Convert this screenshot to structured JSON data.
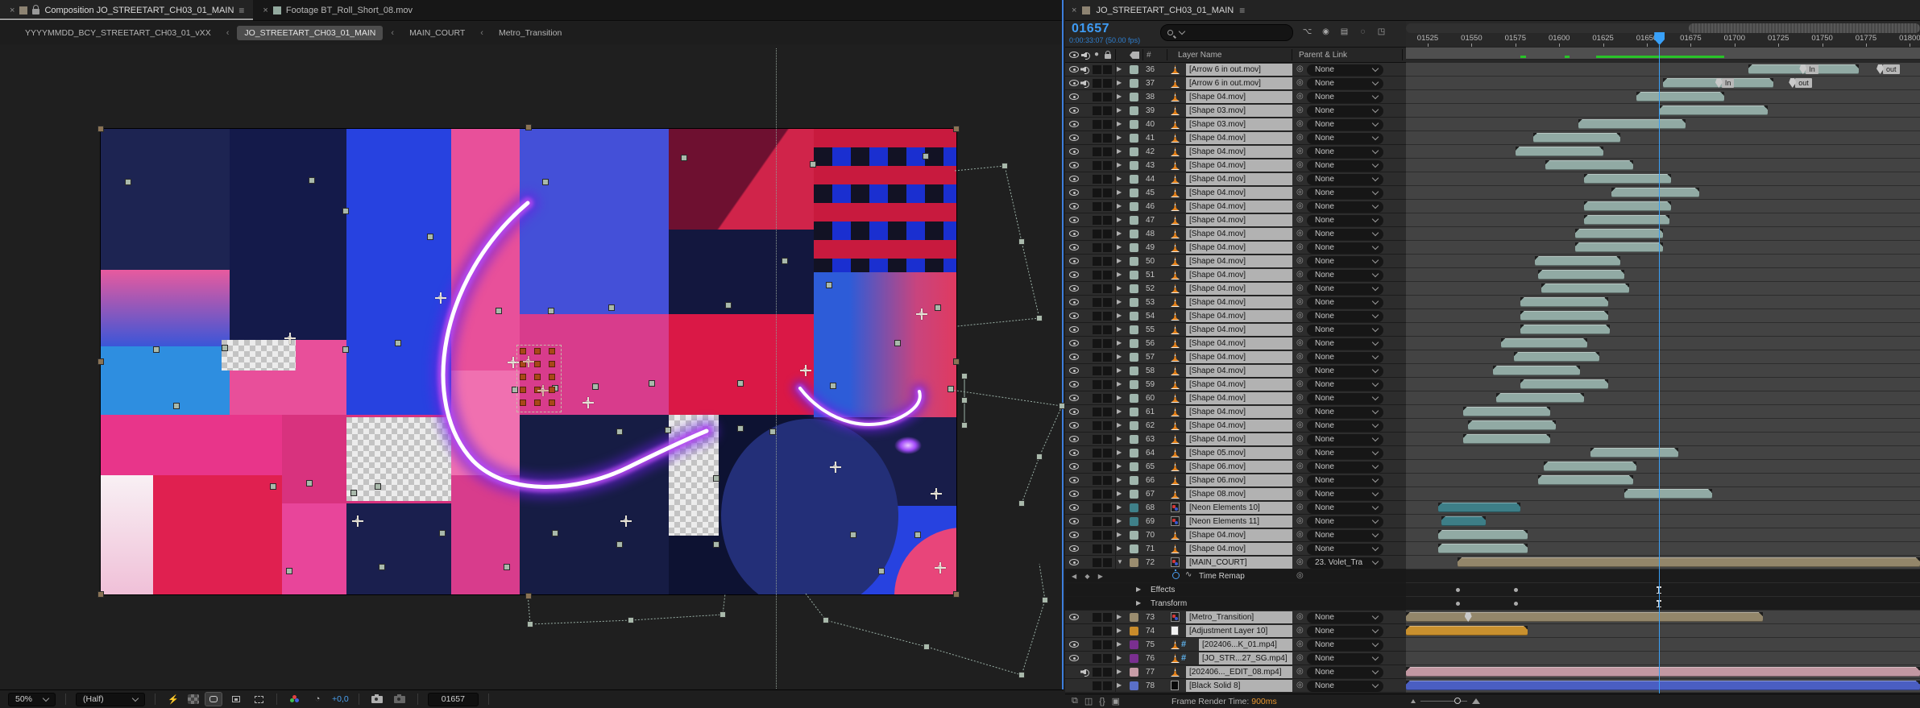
{
  "viewer": {
    "tabs": [
      {
        "label": "Composition JO_STREETART_CH03_01_MAIN",
        "active": true,
        "locked": true
      },
      {
        "label": "Footage BT_Roll_Short_08.mov",
        "active": false
      }
    ],
    "breadcrumbs": [
      "YYYYMMDD_BCY_STREETART_CH03_01_vXX",
      "JO_STREETART_CH03_01_MAIN",
      "MAIN_COURT",
      "Metro_Transition"
    ],
    "active_breadcrumb": "JO_STREETART_CH03_01_MAIN",
    "toolbar": {
      "zoom": "50%",
      "resolution": "(Half)",
      "exposure": "+0,0",
      "timecode": "01657",
      "icons": [
        "fast-previews-icon",
        "transparency-grid-icon",
        "mask-visibility-icon",
        "region-of-interest-icon",
        "guides-crop-icon",
        "channel-rgb-icon",
        "exposure-reset-icon",
        "snapshot-icon",
        "show-snapshot-icon"
      ]
    }
  },
  "timeline": {
    "tab": "JO_STREETART_CH03_01_MAIN",
    "current_frame": "01657",
    "current_time": "0:00:33:07 (50.00 fps)",
    "playhead_frame": 1657,
    "columns": {
      "layer_name": "Layer Name",
      "parent": "Parent & Link",
      "number": "#"
    },
    "mode_icons": [
      "composition-mini-flowchart-icon",
      "shy-layers-icon",
      "frame-blending-icon",
      "motion-blur-icon",
      "graph-editor-icon"
    ],
    "ruler_ticks": [
      "01525",
      "01550",
      "01575",
      "01600",
      "01625",
      "01650",
      "01675",
      "01700",
      "01725",
      "01750",
      "01775",
      "01800"
    ],
    "ruler_start": 1525,
    "ruler_step": 25,
    "green_cache_segments": [
      [
        1578,
        1581
      ],
      [
        1603,
        1606
      ],
      [
        1621,
        1694
      ]
    ],
    "colors": {
      "chips": {
        "sage": "#9fb5ac",
        "teal": "#3f8089",
        "tan": "#9b8d6f",
        "orange": "#c98c2a",
        "purple": "#7a2f90",
        "pink": "#c79ca6",
        "blue": "#5a6fc8"
      },
      "bars": {
        "sage": "#91aaa4",
        "teal": "#3d7e87",
        "tan": "#93866a",
        "orange": "#c8902e",
        "pink": "#c298a2",
        "blue": "#4a5ec2"
      },
      "accent_blue": "#38a0f8"
    },
    "rows": [
      {
        "num": 36,
        "name": "[Arrow 6 in out.mov]",
        "icon": "footage",
        "chip": "sage",
        "eye": true,
        "audio": true,
        "parent": "None",
        "bar": {
          "s": 1708,
          "e": 1771,
          "c": "sage"
        },
        "markers": [
          {
            "t": "In",
            "f": 1737
          },
          {
            "t": "out",
            "f": 1781
          }
        ]
      },
      {
        "num": 37,
        "name": "[Arrow 6 in out.mov]",
        "icon": "footage",
        "chip": "sage",
        "eye": true,
        "audio": true,
        "parent": "None",
        "bar": {
          "s": 1659,
          "e": 1722,
          "c": "sage"
        },
        "markers": [
          {
            "t": "In",
            "f": 1689
          },
          {
            "t": "out",
            "f": 1731
          }
        ]
      },
      {
        "num": 38,
        "name": "[Shape 04.mov]",
        "icon": "footage",
        "chip": "sage",
        "eye": true,
        "parent": "None",
        "bar": {
          "s": 1644,
          "e": 1694,
          "c": "sage"
        }
      },
      {
        "num": 39,
        "name": "[Shape 03.mov]",
        "icon": "footage",
        "chip": "sage",
        "eye": true,
        "parent": "None",
        "bar": {
          "s": 1657,
          "e": 1719,
          "c": "sage"
        }
      },
      {
        "num": 40,
        "name": "[Shape 03.mov]",
        "icon": "footage",
        "chip": "sage",
        "eye": true,
        "parent": "None",
        "bar": {
          "s": 1611,
          "e": 1672,
          "c": "sage"
        }
      },
      {
        "num": 41,
        "name": "[Shape 04.mov]",
        "icon": "footage",
        "chip": "sage",
        "eye": true,
        "parent": "None",
        "bar": {
          "s": 1585,
          "e": 1635,
          "c": "sage"
        }
      },
      {
        "num": 42,
        "name": "[Shape 04.mov]",
        "icon": "footage",
        "chip": "sage",
        "eye": true,
        "parent": "None",
        "bar": {
          "s": 1575,
          "e": 1625,
          "c": "sage"
        }
      },
      {
        "num": 43,
        "name": "[Shape 04.mov]",
        "icon": "footage",
        "chip": "sage",
        "eye": true,
        "parent": "None",
        "bar": {
          "s": 1592,
          "e": 1642,
          "c": "sage"
        }
      },
      {
        "num": 44,
        "name": "[Shape 04.mov]",
        "icon": "footage",
        "chip": "sage",
        "eye": true,
        "parent": "None",
        "bar": {
          "s": 1614,
          "e": 1664,
          "c": "sage"
        }
      },
      {
        "num": 45,
        "name": "[Shape 04.mov]",
        "icon": "footage",
        "chip": "sage",
        "eye": true,
        "parent": "None",
        "bar": {
          "s": 1630,
          "e": 1680,
          "c": "sage"
        }
      },
      {
        "num": 46,
        "name": "[Shape 04.mov]",
        "icon": "footage",
        "chip": "sage",
        "eye": true,
        "parent": "None",
        "bar": {
          "s": 1614,
          "e": 1664,
          "c": "sage"
        }
      },
      {
        "num": 47,
        "name": "[Shape 04.mov]",
        "icon": "footage",
        "chip": "sage",
        "eye": true,
        "parent": "None",
        "bar": {
          "s": 1614,
          "e": 1663,
          "c": "sage"
        }
      },
      {
        "num": 48,
        "name": "[Shape 04.mov]",
        "icon": "footage",
        "chip": "sage",
        "eye": true,
        "parent": "None",
        "bar": {
          "s": 1609,
          "e": 1659,
          "c": "sage"
        }
      },
      {
        "num": 49,
        "name": "[Shape 04.mov]",
        "icon": "footage",
        "chip": "sage",
        "eye": true,
        "parent": "None",
        "bar": {
          "s": 1609,
          "e": 1659,
          "c": "sage"
        }
      },
      {
        "num": 50,
        "name": "[Shape 04.mov]",
        "icon": "footage",
        "chip": "sage",
        "eye": true,
        "parent": "None",
        "bar": {
          "s": 1586,
          "e": 1635,
          "c": "sage"
        }
      },
      {
        "num": 51,
        "name": "[Shape 04.mov]",
        "icon": "footage",
        "chip": "sage",
        "eye": true,
        "parent": "None",
        "bar": {
          "s": 1588,
          "e": 1637,
          "c": "sage"
        }
      },
      {
        "num": 52,
        "name": "[Shape 04.mov]",
        "icon": "footage",
        "chip": "sage",
        "eye": true,
        "parent": "None",
        "bar": {
          "s": 1590,
          "e": 1640,
          "c": "sage"
        }
      },
      {
        "num": 53,
        "name": "[Shape 04.mov]",
        "icon": "footage",
        "chip": "sage",
        "eye": true,
        "parent": "None",
        "bar": {
          "s": 1578,
          "e": 1628,
          "c": "sage"
        }
      },
      {
        "num": 54,
        "name": "[Shape 04.mov]",
        "icon": "footage",
        "chip": "sage",
        "eye": true,
        "parent": "None",
        "bar": {
          "s": 1578,
          "e": 1628,
          "c": "sage"
        }
      },
      {
        "num": 55,
        "name": "[Shape 04.mov]",
        "icon": "footage",
        "chip": "sage",
        "eye": true,
        "parent": "None",
        "bar": {
          "s": 1578,
          "e": 1629,
          "c": "sage"
        }
      },
      {
        "num": 56,
        "name": "[Shape 04.mov]",
        "icon": "footage",
        "chip": "sage",
        "eye": true,
        "parent": "None",
        "bar": {
          "s": 1567,
          "e": 1616,
          "c": "sage"
        }
      },
      {
        "num": 57,
        "name": "[Shape 04.mov]",
        "icon": "footage",
        "chip": "sage",
        "eye": true,
        "parent": "None",
        "bar": {
          "s": 1574,
          "e": 1623,
          "c": "sage"
        }
      },
      {
        "num": 58,
        "name": "[Shape 04.mov]",
        "icon": "footage",
        "chip": "sage",
        "eye": true,
        "parent": "None",
        "bar": {
          "s": 1562,
          "e": 1612,
          "c": "sage"
        }
      },
      {
        "num": 59,
        "name": "[Shape 04.mov]",
        "icon": "footage",
        "chip": "sage",
        "eye": true,
        "parent": "None",
        "bar": {
          "s": 1578,
          "e": 1628,
          "c": "sage"
        }
      },
      {
        "num": 60,
        "name": "[Shape 04.mov]",
        "icon": "footage",
        "chip": "sage",
        "eye": true,
        "parent": "None",
        "bar": {
          "s": 1564,
          "e": 1614,
          "c": "sage"
        }
      },
      {
        "num": 61,
        "name": "[Shape 04.mov]",
        "icon": "footage",
        "chip": "sage",
        "eye": true,
        "parent": "None",
        "bar": {
          "s": 1545,
          "e": 1595,
          "c": "sage"
        }
      },
      {
        "num": 62,
        "name": "[Shape 04.mov]",
        "icon": "footage",
        "chip": "sage",
        "eye": true,
        "parent": "None",
        "bar": {
          "s": 1548,
          "e": 1598,
          "c": "sage"
        }
      },
      {
        "num": 63,
        "name": "[Shape 04.mov]",
        "icon": "footage",
        "chip": "sage",
        "eye": true,
        "parent": "None",
        "bar": {
          "s": 1545,
          "e": 1595,
          "c": "sage"
        }
      },
      {
        "num": 64,
        "name": "[Shape 05.mov]",
        "icon": "footage",
        "chip": "sage",
        "eye": true,
        "parent": "None",
        "bar": {
          "s": 1618,
          "e": 1668,
          "c": "sage"
        }
      },
      {
        "num": 65,
        "name": "[Shape 06.mov]",
        "icon": "footage",
        "chip": "sage",
        "eye": true,
        "parent": "None",
        "bar": {
          "s": 1591,
          "e": 1644,
          "c": "sage"
        }
      },
      {
        "num": 66,
        "name": "[Shape 06.mov]",
        "icon": "footage",
        "chip": "sage",
        "eye": true,
        "parent": "None",
        "bar": {
          "s": 1588,
          "e": 1642,
          "c": "sage"
        }
      },
      {
        "num": 67,
        "name": "[Shape 08.mov]",
        "icon": "footage",
        "chip": "sage",
        "eye": true,
        "parent": "None",
        "bar": {
          "s": 1637,
          "e": 1687,
          "c": "sage"
        }
      },
      {
        "num": 68,
        "name": "[Neon Elements 10]",
        "icon": "comp",
        "chip": "teal",
        "eye": true,
        "parent": "None",
        "bar": {
          "s": 1531,
          "e": 1578,
          "c": "teal"
        }
      },
      {
        "num": 69,
        "name": "[Neon Elements 11]",
        "icon": "comp",
        "chip": "teal",
        "eye": true,
        "parent": "None",
        "bar": {
          "s": 1533,
          "e": 1558,
          "c": "teal"
        }
      },
      {
        "num": 70,
        "name": "[Shape 04.mov]",
        "icon": "footage",
        "chip": "sage",
        "eye": true,
        "parent": "None",
        "bar": {
          "s": 1531,
          "e": 1582,
          "c": "sage"
        }
      },
      {
        "num": 71,
        "name": "[Shape 04.mov]",
        "icon": "footage",
        "chip": "sage",
        "eye": true,
        "parent": "None",
        "bar": {
          "s": 1531,
          "e": 1582,
          "c": "sage"
        }
      },
      {
        "num": 72,
        "name": "[MAIN_COURT]",
        "icon": "comp",
        "chip": "tan",
        "eye": true,
        "expanded": true,
        "parent": "23. Volet_Tra",
        "bar": {
          "s": 1542,
          "e": 1808,
          "c": "tan"
        }
      },
      {
        "prop": "Time Remap",
        "nav": true,
        "stopwatch": true
      },
      {
        "prop": "Effects",
        "dots": [
          1541,
          1574
        ],
        "ibeam": 1657
      },
      {
        "prop": "Transform",
        "dots": [
          1541,
          1574
        ],
        "ibeam": 1657
      },
      {
        "num": 73,
        "name": "[Metro_Transition]",
        "icon": "comp",
        "chip": "tan",
        "eye": true,
        "parent": "None",
        "bar": {
          "s": 1510,
          "e": 1716,
          "c": "tan"
        },
        "markers": [
          {
            "t": "",
            "f": 1546
          }
        ]
      },
      {
        "num": 74,
        "name": "[Adjustment Layer 10]",
        "icon": "adj",
        "chip": "orange",
        "eye": false,
        "parent": "None",
        "bar": {
          "s": 1510,
          "e": 1582,
          "c": "orange"
        }
      },
      {
        "num": 75,
        "name": "[202406...K_01.mp4]",
        "icon": "footage",
        "rast": true,
        "chip": "purple",
        "eye": true,
        "parent": "None"
      },
      {
        "num": 76,
        "name": "[JO_STR...27_SG.mp4]",
        "icon": "footage",
        "rast": true,
        "chip": "purple",
        "eye": true,
        "parent": "None"
      },
      {
        "num": 77,
        "name": "[202406..._EDIT_08.mp4]",
        "icon": "footage",
        "chip": "pink",
        "eye": false,
        "audio": true,
        "parent": "None",
        "bar": {
          "s": 1510,
          "e": 1808,
          "c": "pink"
        }
      },
      {
        "num": 78,
        "name": "[Black Solid 8]",
        "icon": "solid",
        "chip": "blue",
        "eye": false,
        "parent": "None",
        "bar": {
          "s": 1510,
          "e": 1808,
          "c": "blue"
        }
      }
    ],
    "footer": {
      "icons": [
        "layer-switches-pane-icon",
        "transfer-controls-pane-icon",
        "in-out-duration-pane-icon",
        "render-pane-icon"
      ],
      "frame_render_label": "Frame Render Time:",
      "frame_render_value": "900ms"
    }
  }
}
